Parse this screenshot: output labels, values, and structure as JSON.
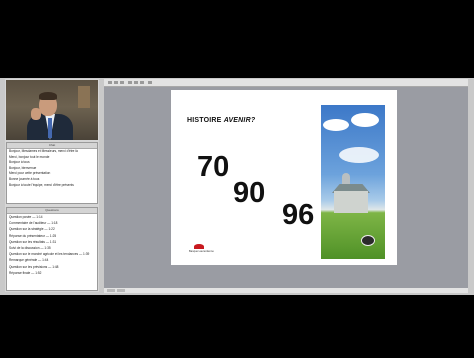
{
  "slide": {
    "title_prefix": "HISTOIRE",
    "title_em": "AVENIR?",
    "numbers": [
      "70",
      "90",
      "96"
    ],
    "logo_text": "Banque Laurentienne"
  },
  "chat": {
    "header": "Chat",
    "messages": [
      "Bonjour, Mesdames et Messieurs, merci d'être là",
      "Merci, bonjour tout le monde",
      "Bonjour à tous",
      "Bonjour, bienvenue",
      "Merci pour cette présentation",
      "Bonne journée à tous",
      "Bonjour à toute l'équipe, merci d'être présents"
    ]
  },
  "qa": {
    "header": "Questions",
    "items": [
      "Question posée — 1:14",
      "Commentaire de l'auditeur — 1:18",
      "Question sur la stratégie — 1:22",
      "Réponse du présentateur — 1:25",
      "Question sur les résultats — 1:31",
      "Suivi de la discussion — 1:35",
      "Question sur le marché agricole et les tendances — 1:39",
      "Remarque générale — 1:44",
      "Question sur les prévisions — 1:48",
      "Réponse finale — 1:52"
    ]
  }
}
